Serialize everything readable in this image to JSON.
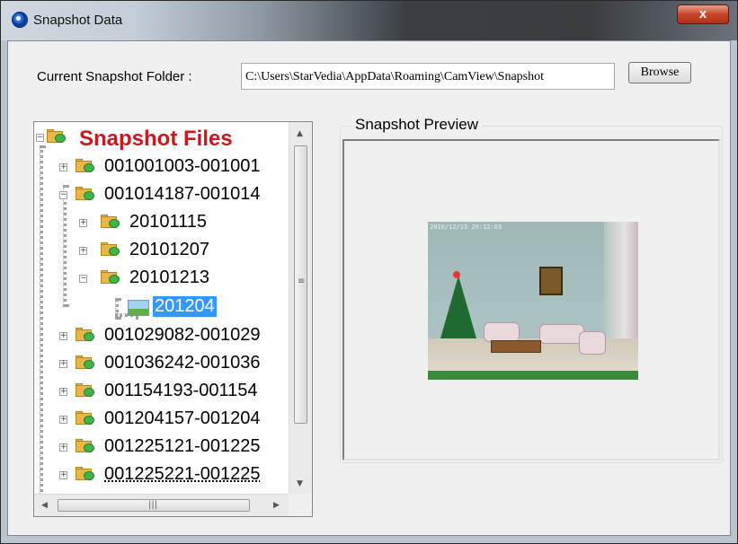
{
  "window": {
    "title": "Snapshot Data",
    "close_label": "x"
  },
  "folder": {
    "label": "Current Snapshot Folder :",
    "path": "C:\\Users\\StarVedia\\AppData\\Roaming\\CamView\\Snapshot",
    "browse_label": "Browse"
  },
  "tree": {
    "root": "Snapshot Files",
    "items": [
      {
        "label": "001001003-001001",
        "expanded": false
      },
      {
        "label": "001014187-001014",
        "expanded": true
      },
      {
        "label": "20101115",
        "expanded": false
      },
      {
        "label": "20101207",
        "expanded": false
      },
      {
        "label": "20101213",
        "expanded": true
      },
      {
        "label": "201204",
        "selected": true
      },
      {
        "label": "001029082-001029",
        "expanded": false
      },
      {
        "label": "001036242-001036",
        "expanded": false
      },
      {
        "label": "001154193-001154",
        "expanded": false
      },
      {
        "label": "001204157-001204",
        "expanded": false
      },
      {
        "label": "001225121-001225",
        "expanded": false
      },
      {
        "label": "001225221-001225",
        "expanded": false
      }
    ]
  },
  "preview": {
    "title": "Snapshot Preview",
    "timestamp": "2010/12/13 20:12:03"
  },
  "colors": {
    "root_label": "#c8191e",
    "selection": "#3399ff"
  }
}
